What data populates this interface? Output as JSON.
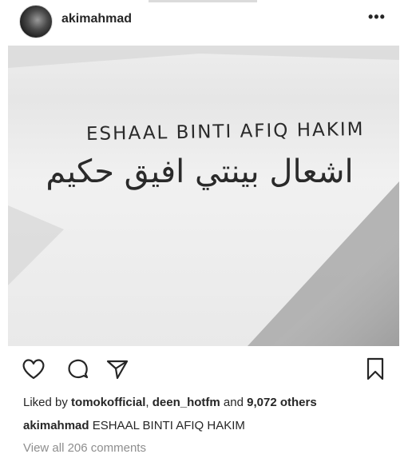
{
  "post": {
    "username": "akimahmad",
    "more_label": "•••",
    "photo": {
      "handwritten_latin": "ESHAAL BINTI AFIQ HAKIM",
      "handwritten_arabic": "اشعال بينتي افيق حكيم"
    },
    "actions": {
      "like_icon": "heart-icon",
      "comment_icon": "comment-icon",
      "share_icon": "send-icon",
      "save_icon": "bookmark-icon"
    },
    "likes": {
      "prefix": "Liked by ",
      "user1": "tomokofficial",
      "separator": ", ",
      "user2": "deen_hotfm",
      "and": " and ",
      "others": "9,072 others"
    },
    "caption": {
      "username": "akimahmad",
      "text": "ESHAAL BINTI AFIQ HAKIM"
    },
    "view_comments": "View all 206 comments"
  }
}
